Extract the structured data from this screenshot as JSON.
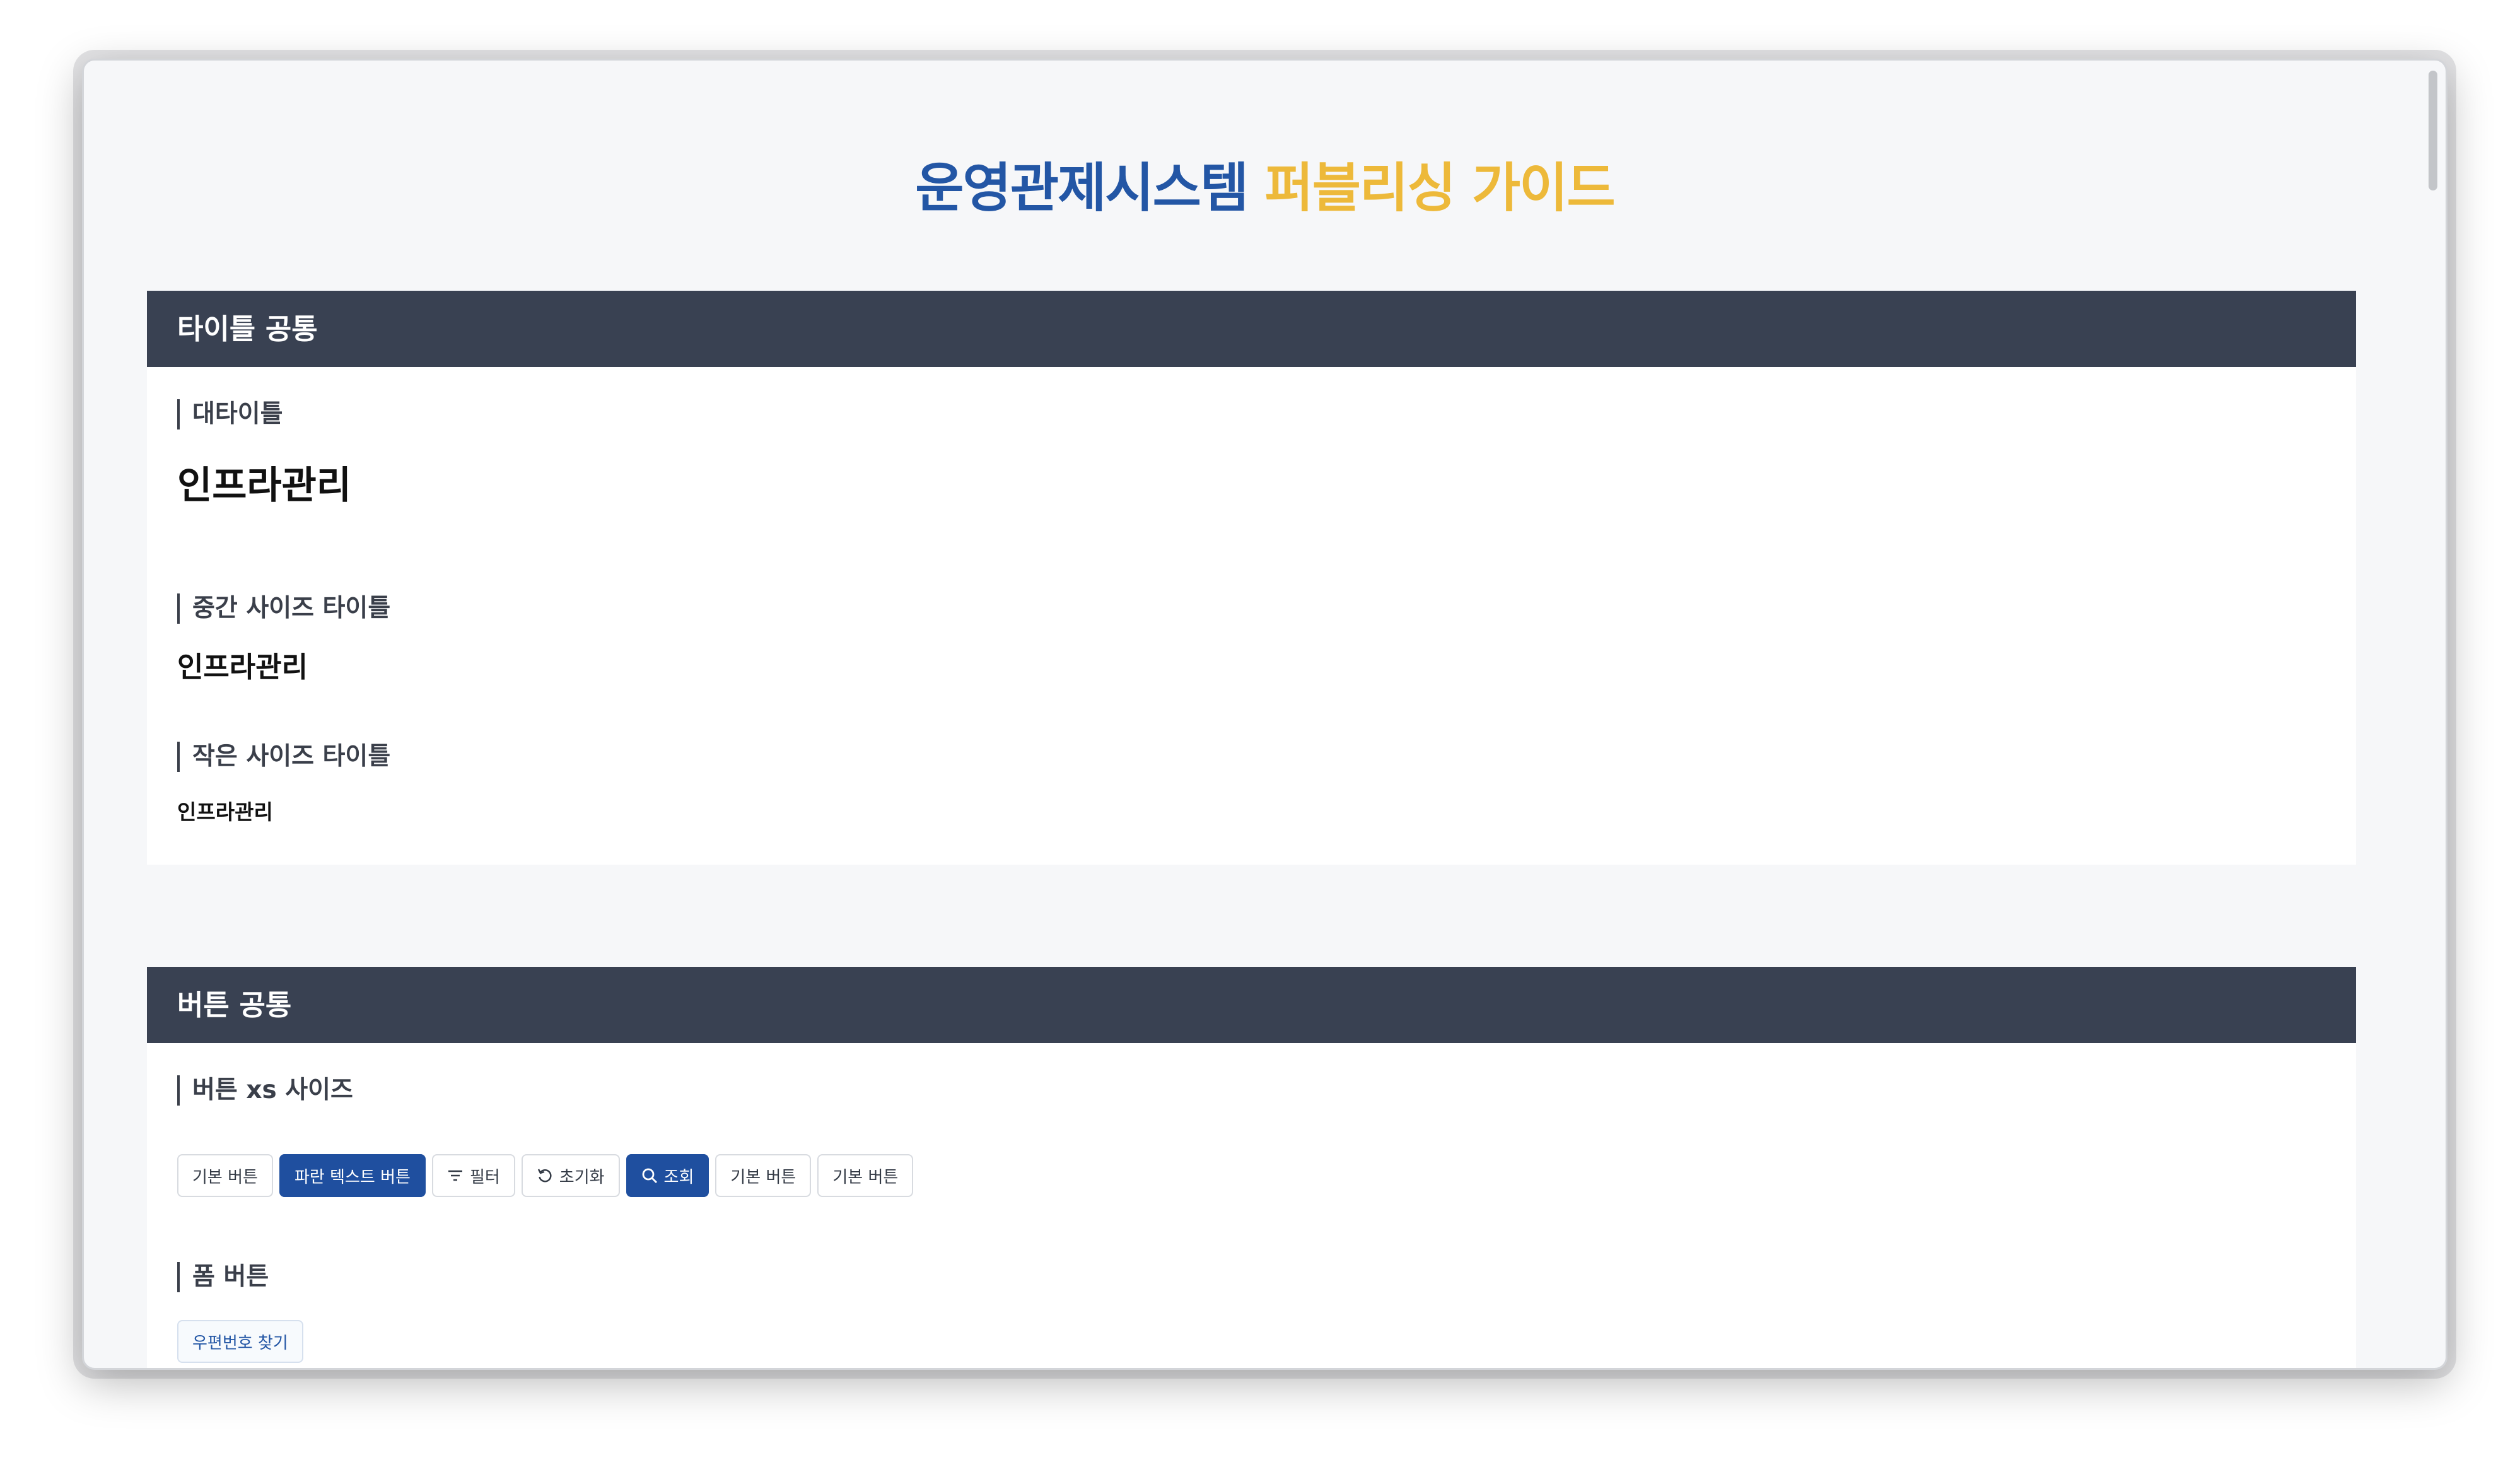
{
  "page": {
    "title_part1": "운영관제시스템",
    "title_part2": "퍼블리싱 가이드",
    "colors": {
      "title_blue": "#2356a5",
      "title_yellow": "#edb93a",
      "section_header_bg": "#394152",
      "primary_button": "#1f4f9f"
    }
  },
  "sections": {
    "title_common": {
      "header": "타이틀 공통",
      "large_label": "대타이틀",
      "large_sample": "인프라관리",
      "medium_label": "중간 사이즈 타이틀",
      "medium_sample": "인프라관리",
      "small_label": "작은 사이즈 타이틀",
      "small_sample": "인프라관리"
    },
    "button_common": {
      "header": "버튼 공통",
      "xs_label": "버튼 xs 사이즈",
      "xs_buttons": {
        "basic_1": "기본 버튼",
        "blue_text": "파란 텍스트 버튼",
        "filter": "필터",
        "reset": "초기화",
        "search": "조회",
        "basic_2": "기본 버튼",
        "basic_3": "기본 버튼"
      },
      "icons": {
        "filter": "filter-icon",
        "reset": "reset-icon",
        "search": "search-icon"
      },
      "form_label": "폼 버튼",
      "form_buttons": {
        "postal_search": "우편번호 찾기"
      }
    }
  }
}
